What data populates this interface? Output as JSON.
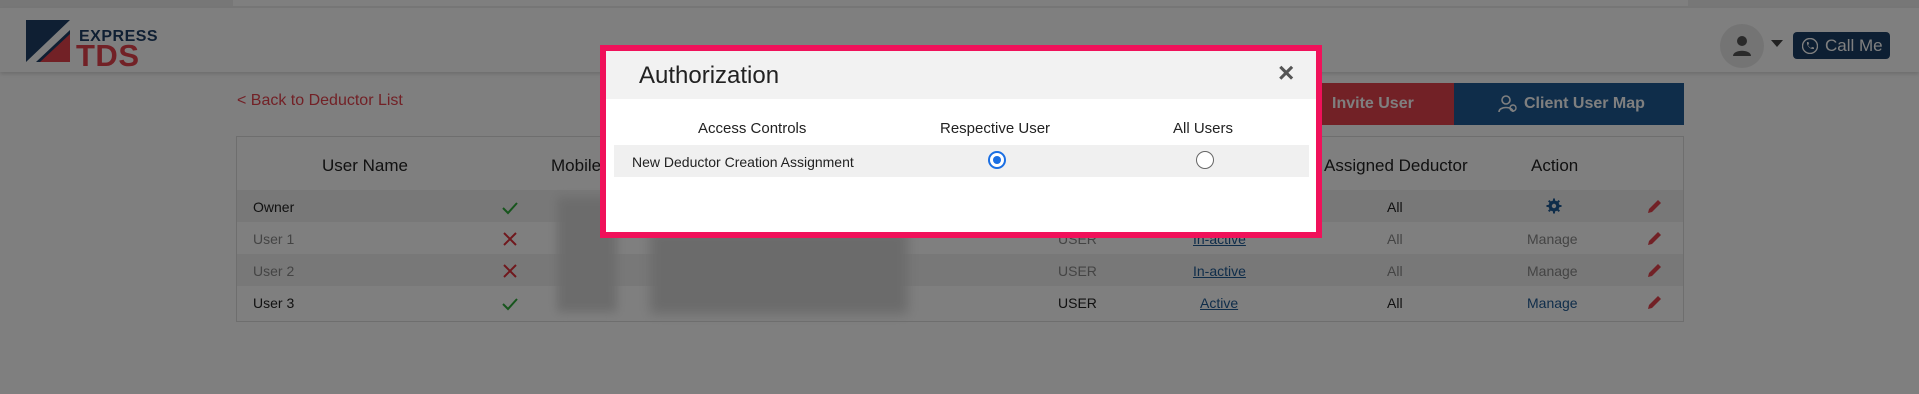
{
  "brand": {
    "top": "EXPRESS",
    "bottom": "TDS"
  },
  "header": {
    "call_label": "Call Me"
  },
  "nav": {
    "back_label": "< Back to Deductor List"
  },
  "actions": {
    "invite_label": "Invite User",
    "client_map_label": "Client User Map"
  },
  "table": {
    "headers": {
      "user_name": "User Name",
      "mobile": "Mobile",
      "assigned_deductor": "Assigned Deductor",
      "action": "Action"
    },
    "rows": [
      {
        "name": "Owner",
        "role": "",
        "status": "",
        "deductor": "All",
        "action": ""
      },
      {
        "name": "User 1",
        "role": "USER",
        "status": "In-active",
        "deductor": "All",
        "action": "Manage"
      },
      {
        "name": "User 2",
        "role": "USER",
        "status": "In-active",
        "deductor": "All",
        "action": "Manage"
      },
      {
        "name": "User 3",
        "role": "USER",
        "status": "Active",
        "deductor": "All",
        "action": "Manage"
      }
    ]
  },
  "modal": {
    "title": "Authorization",
    "close_glyph": "×",
    "columns": [
      "Access Controls",
      "Respective User",
      "All Users"
    ],
    "rows": [
      {
        "label": "New Deductor Creation Assignment",
        "selected": "Respective User"
      }
    ]
  },
  "colors": {
    "brand_blue": "#1e3f66",
    "brand_red": "#e4424d",
    "highlight": "#f0115a",
    "radio_selected": "#1b6fe3",
    "check_green": "#2eaa3a",
    "cross_red": "#e0303a"
  },
  "icons": [
    "user-icon",
    "phone-icon",
    "user-plus-icon",
    "client-map-icon",
    "check-icon",
    "cross-icon",
    "gear-icon",
    "pencil-icon",
    "close-icon"
  ]
}
